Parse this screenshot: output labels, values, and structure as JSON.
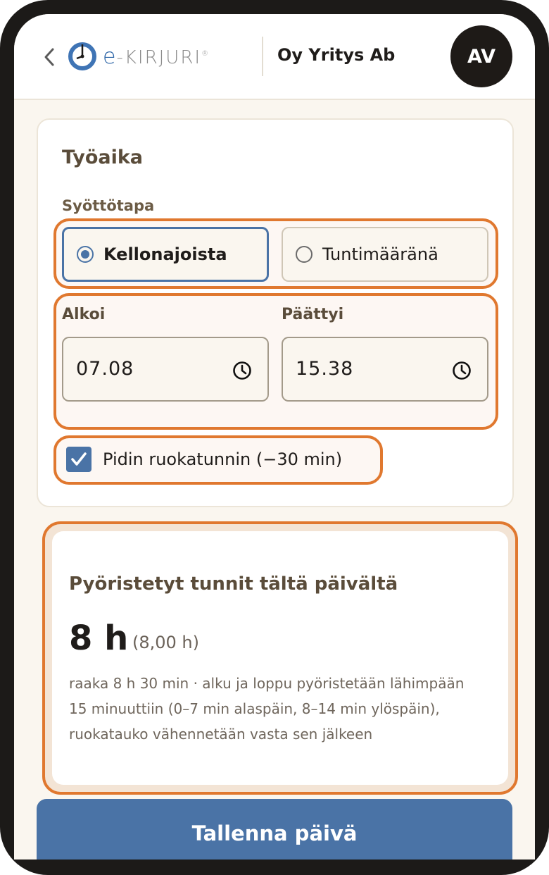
{
  "header": {
    "back_icon": "chevron-left-icon",
    "logo": {
      "prefix": "e",
      "rest": "-KIRJURI",
      "mark": "®"
    },
    "company": "Oy Yritys Ab",
    "avatar_initials": "AV"
  },
  "work_time": {
    "title": "Työaika",
    "mode_label": "Syöttötapa",
    "modes": [
      {
        "label": "Kellonajoista",
        "selected": true
      },
      {
        "label": "Tuntimääränä",
        "selected": false
      }
    ],
    "start": {
      "label": "Alkoi",
      "value": "07.08",
      "icon": "clock-icon"
    },
    "end": {
      "label": "Päättyi",
      "value": "15.38",
      "icon": "clock-icon"
    },
    "lunch": {
      "label": "Pidin ruokatunnin (−30 min)",
      "checked": true
    }
  },
  "summary": {
    "title": "Pyöristetyt tunnit tältä päivältä",
    "hours": "8 h",
    "decimal": "(8,00 h)",
    "note": "raaka 8 h 30 min · alku ja loppu pyöristetään lähimpään 15 minuuttiin (0–7 min alaspäin, 8–14 min ylöspäin), ruokatauko vähennetään vasta sen jälkeen"
  },
  "actions": {
    "save_label": "Tallenna päivä"
  },
  "colors": {
    "accent": "#4a73a6",
    "highlight": "#e0782f",
    "dark": "#1e1a17",
    "background": "#faf6ef"
  }
}
